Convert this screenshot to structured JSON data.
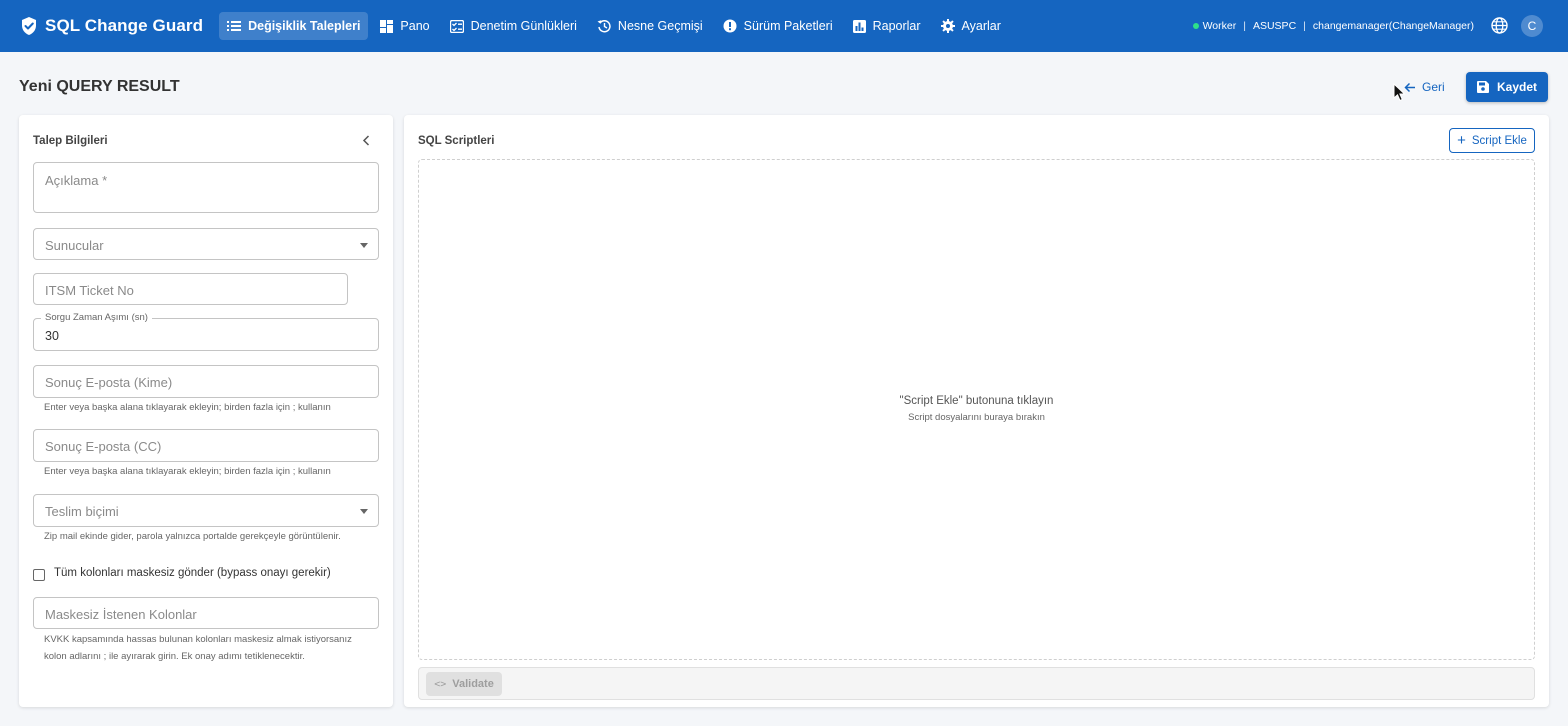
{
  "app": {
    "title": "SQL Change Guard"
  },
  "nav": {
    "items": [
      {
        "label": "Değişiklik Talepleri",
        "icon": "list-icon",
        "active": true
      },
      {
        "label": "Pano",
        "icon": "dashboard-icon"
      },
      {
        "label": "Denetim Günlükleri",
        "icon": "checklist-icon"
      },
      {
        "label": "Nesne Geçmişi",
        "icon": "history-icon"
      },
      {
        "label": "Sürüm Paketleri",
        "icon": "badge-icon"
      },
      {
        "label": "Raporlar",
        "icon": "bar-chart-icon"
      },
      {
        "label": "Ayarlar",
        "icon": "gear-icon"
      }
    ]
  },
  "status": {
    "worker": "Worker",
    "host": "ASUSPC",
    "separator": "|",
    "user": "changemanager(ChangeManager)",
    "dot_color": "#2ee08a"
  },
  "avatar": {
    "initial": "C"
  },
  "page": {
    "title": "Yeni QUERY RESULT",
    "back_label": "Geri",
    "save_label": "Kaydet"
  },
  "form": {
    "title": "Talep Bilgileri",
    "description_placeholder": "Açıklama *",
    "servers_placeholder": "Sunucular",
    "itsm_placeholder": "ITSM Ticket No",
    "timeout_label": "Sorgu Zaman Aşımı (sn)",
    "timeout_value": "30",
    "email_to_placeholder": "Sonuç E-posta (Kime)",
    "email_to_helper": "Enter veya başka alana tıklayarak ekleyin; birden fazla için ; kullanın",
    "email_cc_placeholder": "Sonuç E-posta (CC)",
    "email_cc_helper": "Enter veya başka alana tıklayarak ekleyin; birden fazla için ; kullanın",
    "delivery_placeholder": "Teslim biçimi",
    "delivery_helper": "Zip mail ekinde gider, parola yalnızca portalde gerekçeyle görüntülenir.",
    "unmask_all_label": "Tüm kolonları maskesiz gönder (bypass onayı gerekir)",
    "unmask_all_checked": false,
    "unmasked_columns_placeholder": "Maskesiz İstenen Kolonlar",
    "unmasked_helper_line1": "KVKK kapsamında hassas bulunan kolonları maskesiz almak istiyorsanız",
    "unmasked_helper_line2": "kolon adlarını ; ile ayırarak girin. Ek onay adımı tetiklenecektir."
  },
  "scripts": {
    "title": "SQL Scriptleri",
    "add_label": "Script Ekle",
    "empty_main": "\"Script Ekle\" butonuna tıklayın",
    "empty_sub": "Script dosyalarını buraya bırakın",
    "validate_label": "Validate"
  },
  "colors": {
    "primary": "#1565c0",
    "background": "#f4f6f9"
  }
}
